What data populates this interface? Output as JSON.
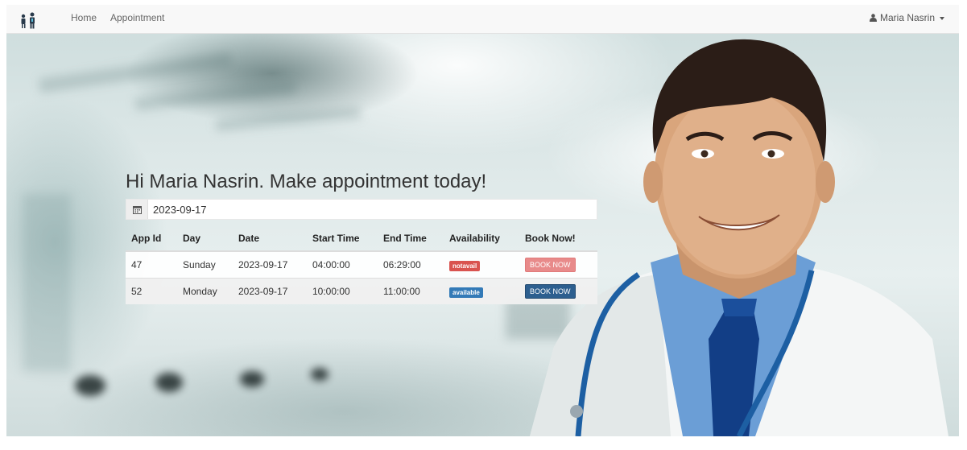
{
  "navbar": {
    "brand_icon": "doctor-patient-logo-icon",
    "links": [
      {
        "label": "Home"
      },
      {
        "label": "Appointment"
      }
    ],
    "user": {
      "icon": "user-icon",
      "name": "Maria Nasrin"
    }
  },
  "main": {
    "heading": "Hi Maria Nasrin. Make appointment today!",
    "date_icon": "calendar-icon",
    "date_value": "2023-09-17",
    "table": {
      "headers": [
        "App Id",
        "Day",
        "Date",
        "Start Time",
        "End Time",
        "Availability",
        "Book Now!"
      ],
      "rows": [
        {
          "app_id": "47",
          "day": "Sunday",
          "date": "2023-09-17",
          "start": "04:00:00",
          "end": "06:29:00",
          "availability": "notavail",
          "availability_color": "#d9534f",
          "book_label": "BOOK NOW",
          "book_color": "#e88a8a",
          "book_enabled": false
        },
        {
          "app_id": "52",
          "day": "Monday",
          "date": "2023-09-17",
          "start": "10:00:00",
          "end": "11:00:00",
          "availability": "available",
          "availability_color": "#337ab7",
          "book_label": "BOOK NOW",
          "book_color": "#2d5f8f",
          "book_enabled": true
        }
      ]
    }
  },
  "colors": {
    "navbar_bg": "#f8f8f8",
    "danger": "#d9534f",
    "primary": "#337ab7"
  }
}
